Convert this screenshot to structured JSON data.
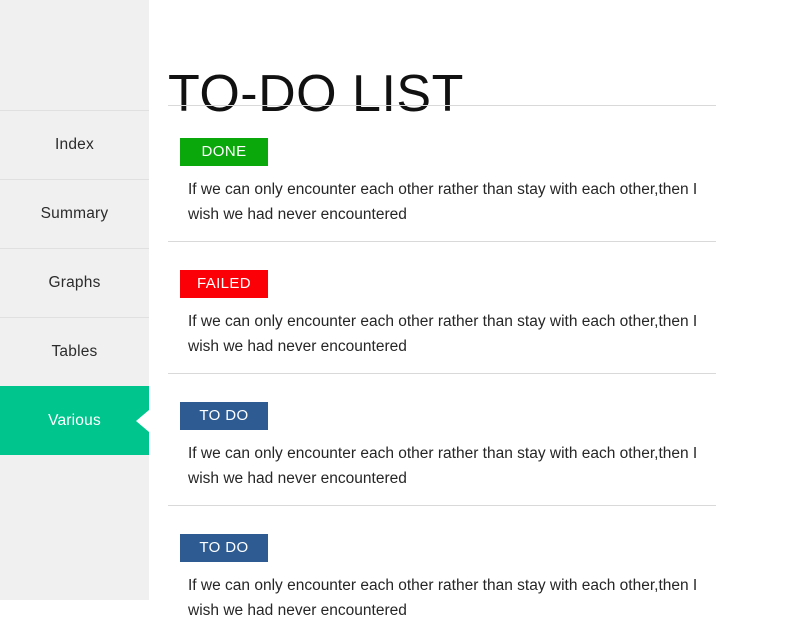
{
  "sidebar": {
    "items": [
      {
        "label": "Index",
        "active": false
      },
      {
        "label": "Summary",
        "active": false
      },
      {
        "label": "Graphs",
        "active": false
      },
      {
        "label": "Tables",
        "active": false
      },
      {
        "label": "Various",
        "active": true
      }
    ],
    "background_color": "#f0f0f0",
    "active_color": "#00c58c"
  },
  "main": {
    "title": "TO-DO LIST",
    "items": [
      {
        "status": "DONE",
        "status_type": "done",
        "status_color": "#0aa80a",
        "text": "If we can only encounter each other rather than stay with each other,then I wish we had never encountered"
      },
      {
        "status": "FAILED",
        "status_type": "failed",
        "status_color": "#fb0007",
        "text": "If we can only encounter each other rather than stay with each other,then I wish we had never encountered"
      },
      {
        "status": "TO DO",
        "status_type": "todo",
        "status_color": "#2e5c92",
        "text": "If we can only encounter each other rather than stay with each other,then I wish we had never encountered"
      },
      {
        "status": "TO DO",
        "status_type": "todo",
        "status_color": "#2e5c92",
        "text": "If we can only encounter each other rather than stay with each other,then I wish we had never encountered"
      }
    ]
  }
}
